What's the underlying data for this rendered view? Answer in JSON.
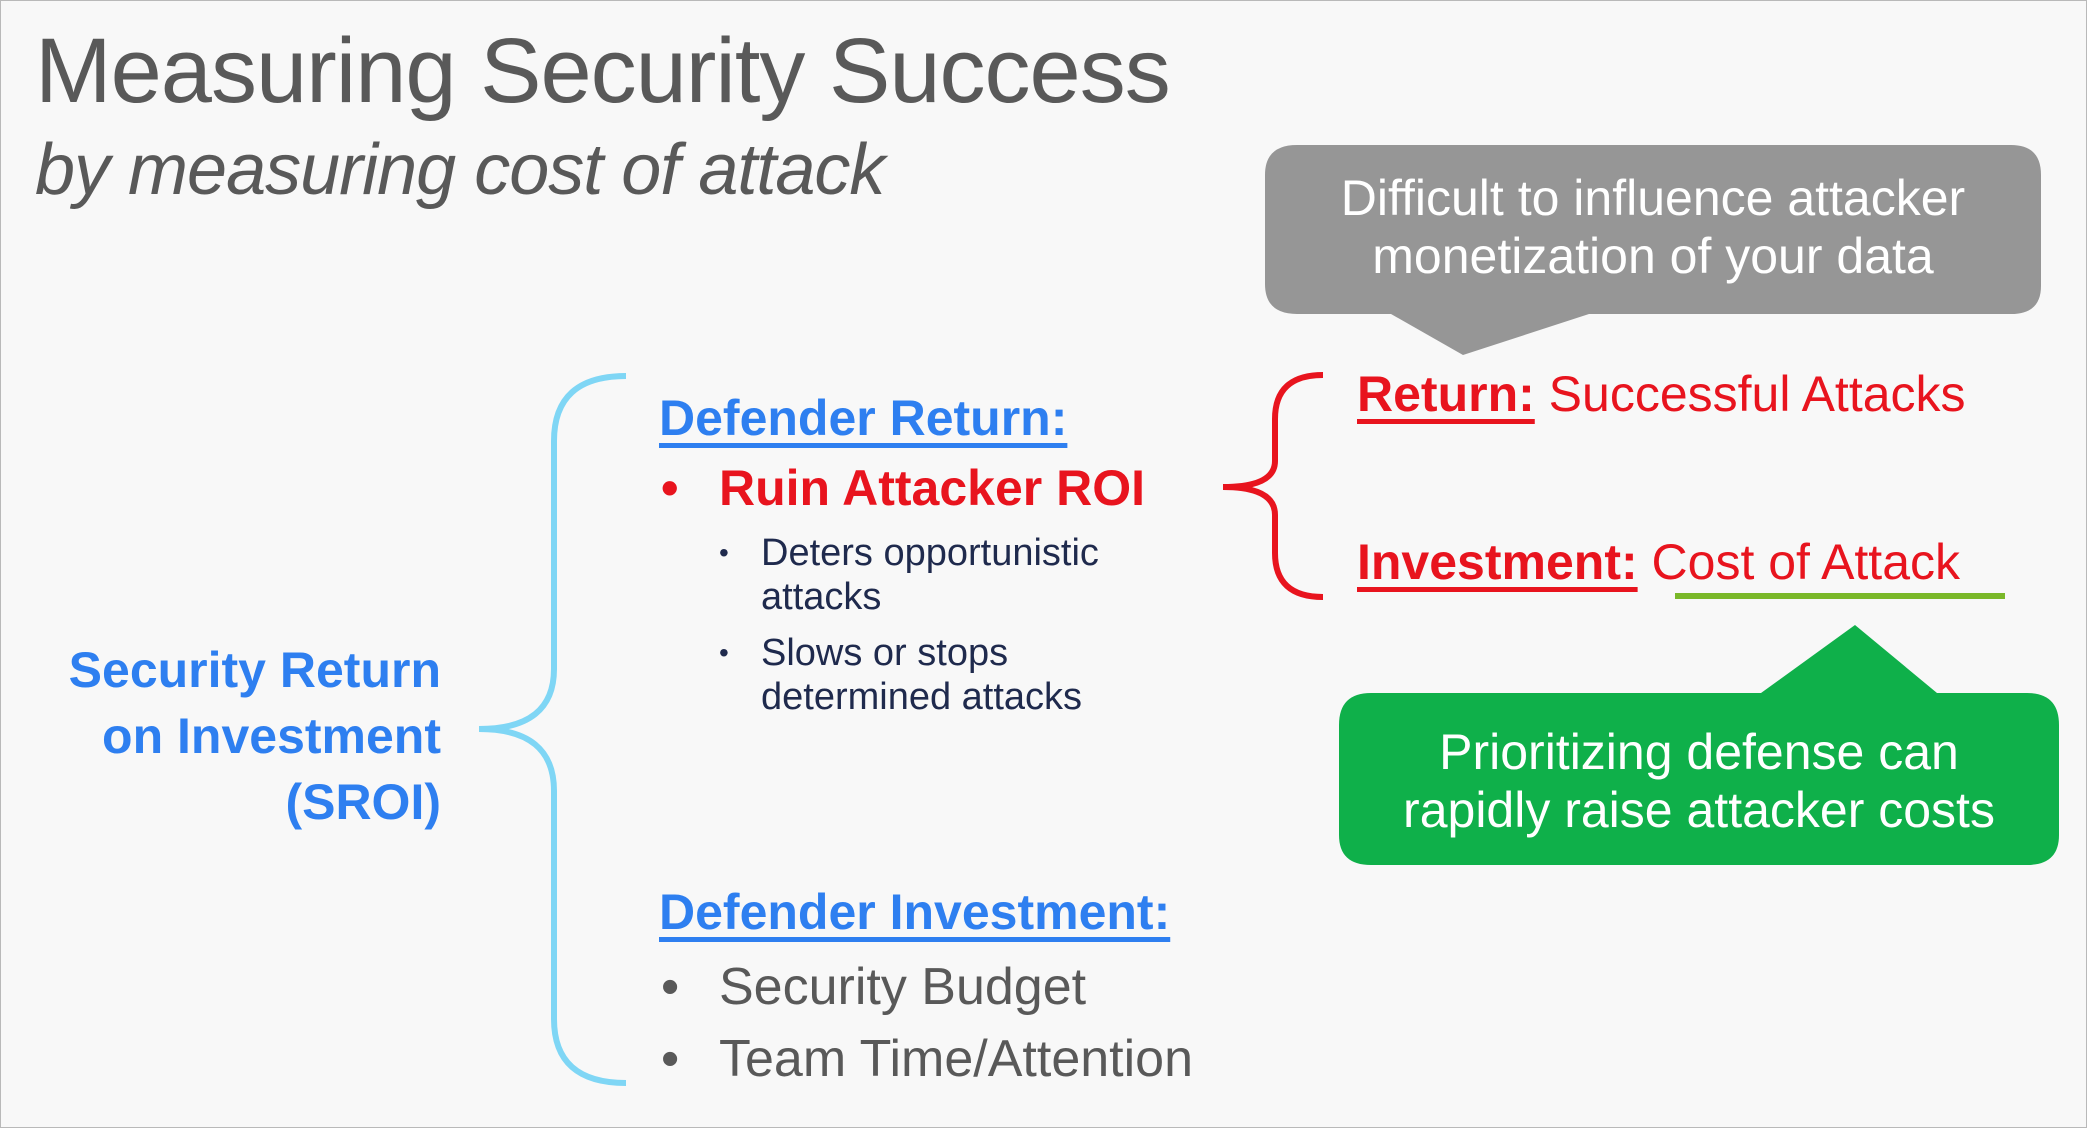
{
  "title": "Measuring Security Success",
  "subtitle": "by measuring cost of attack",
  "sroi": {
    "lines": [
      "Security Return",
      "on Investment",
      "(SROI)"
    ]
  },
  "defender_return": {
    "heading": "Defender Return:",
    "bullet": "Ruin Attacker ROI",
    "subbullets": [
      [
        "Deters opportunistic",
        "attacks"
      ],
      [
        "Slows or stops",
        "determined attacks"
      ]
    ]
  },
  "defender_investment": {
    "heading": "Defender Investment:",
    "bullets": [
      "Security Budget",
      "Team Time/Attention"
    ]
  },
  "attacker": {
    "return_label": "Return:",
    "return_value": "Successful Attacks",
    "investment_label": "Investment:",
    "investment_value": "Cost of Attack"
  },
  "callouts": {
    "gray": [
      "Difficult to influence attacker",
      "monetization of your data"
    ],
    "green": [
      "Prioritizing defense can",
      "rapidly raise attacker costs"
    ]
  },
  "colors": {
    "blue_text": "#2e7ff0",
    "red_text": "#e8141e",
    "light_blue_brace": "#7fd6f5",
    "gray_callout": "#969696",
    "green_callout": "#0fb04a",
    "green_underline": "#7ab829"
  }
}
